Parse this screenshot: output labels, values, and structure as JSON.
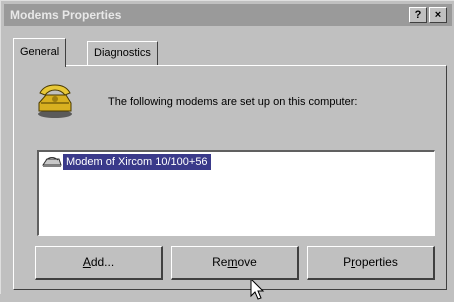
{
  "window": {
    "title": "Modems Properties",
    "help_button": "?",
    "close_button": "×"
  },
  "tabs": [
    {
      "label": "General",
      "active": true
    },
    {
      "label": "Diagnostics",
      "active": false
    }
  ],
  "general": {
    "info_text": "The following modems are set up on this computer:",
    "modems": [
      {
        "name": "Modem of Xircom 10/100+56",
        "selected": true
      }
    ]
  },
  "buttons": {
    "add": {
      "prefix": "",
      "mnemonic": "A",
      "suffix": "dd..."
    },
    "remove": {
      "prefix": "Re",
      "mnemonic": "m",
      "suffix": "ove"
    },
    "properties": {
      "prefix": "P",
      "mnemonic": "r",
      "suffix": "operties"
    }
  },
  "icons": {
    "title_help": "question-mark-icon",
    "title_close": "close-icon",
    "section": "telephone-modem-icon",
    "list_item": "modem-icon",
    "pointer": "mouse-cursor-icon"
  },
  "colors": {
    "titlebar": "#9a9a9a",
    "selection": "#3a3a8a",
    "face": "#c0c0c0"
  }
}
